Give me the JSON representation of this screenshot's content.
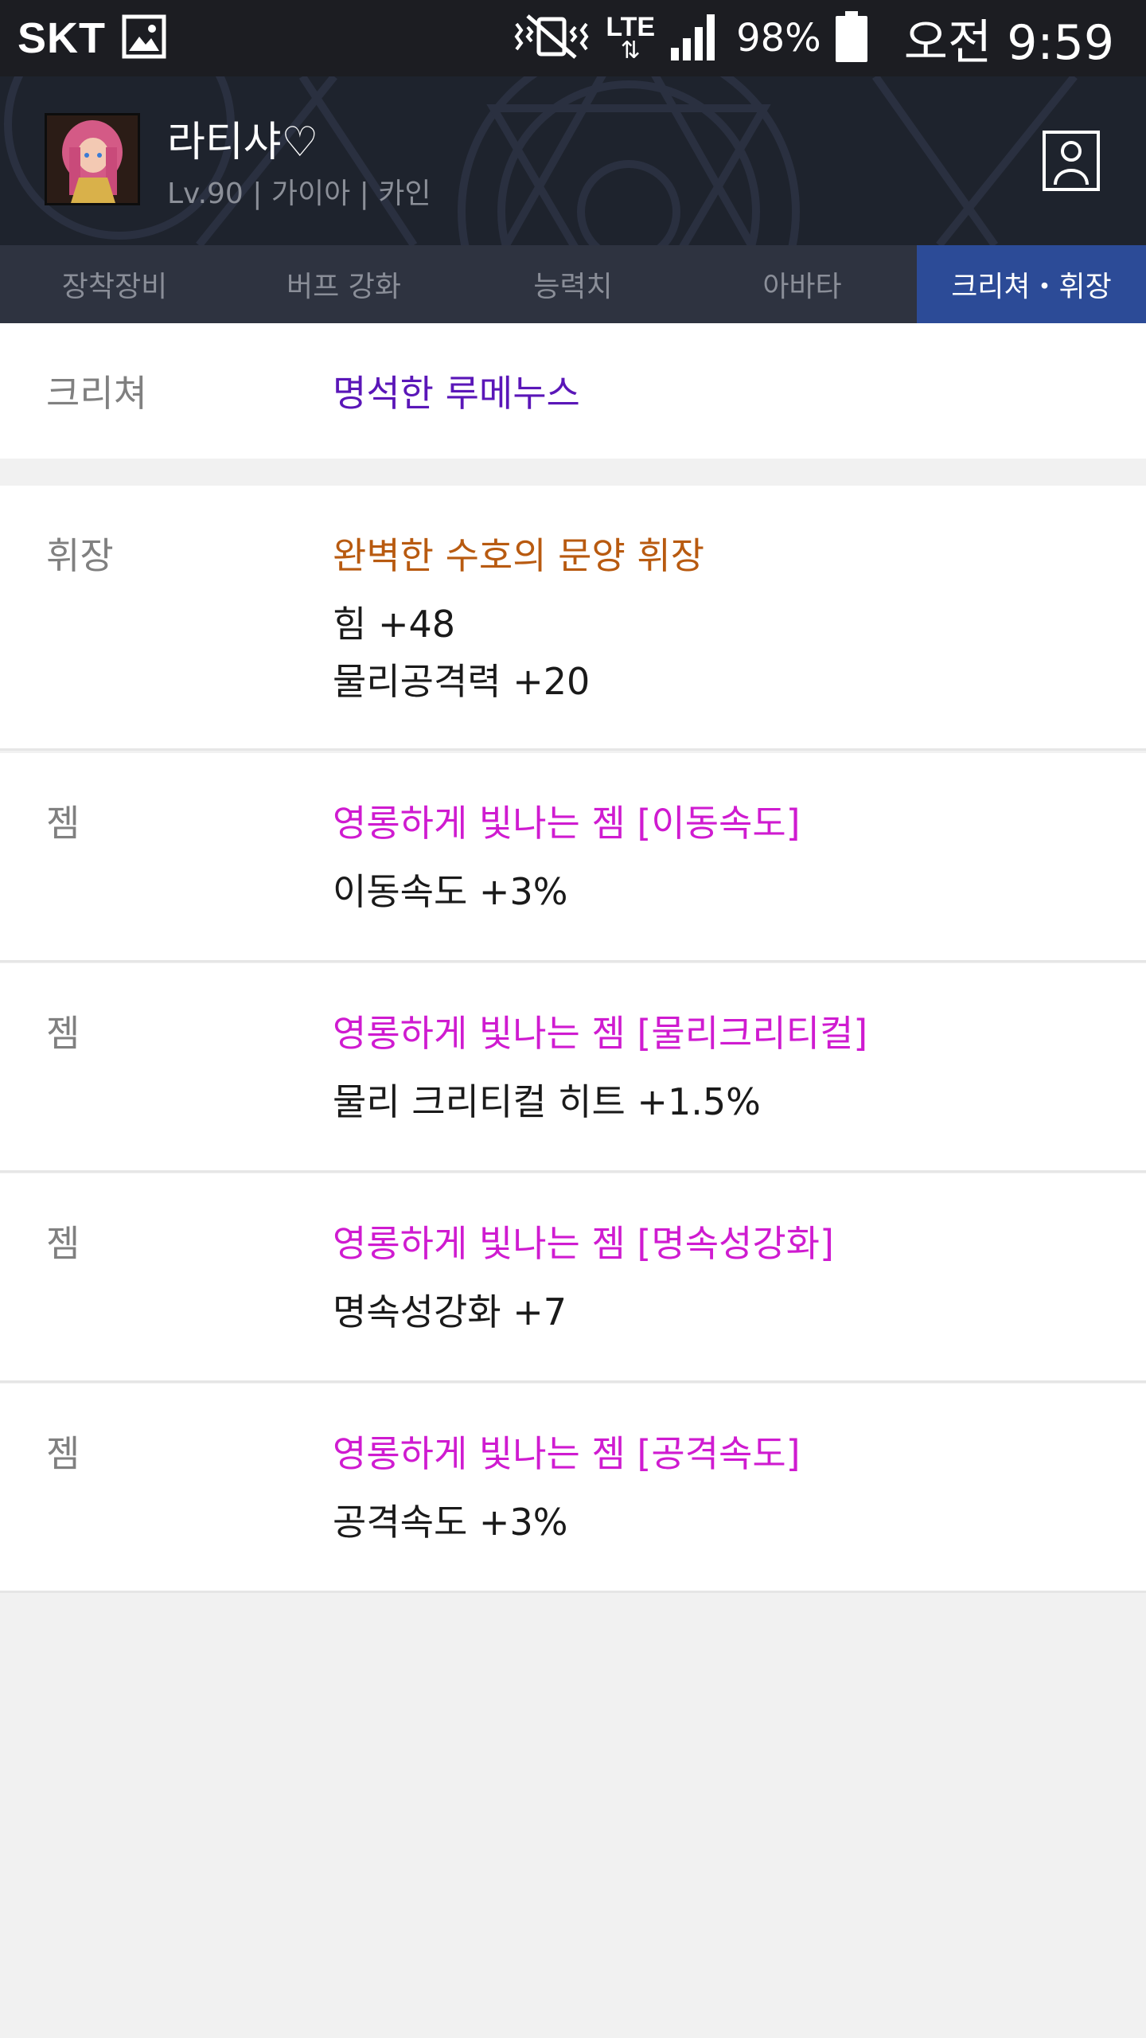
{
  "status_bar": {
    "carrier": "SKT",
    "network": "LTE",
    "battery": "98%",
    "time": "오전 9:59"
  },
  "header": {
    "character_name": "라티샤♡",
    "character_sub": "Lv.90 | 가이아 | 카인"
  },
  "tabs": [
    {
      "label": "장착장비",
      "active": false
    },
    {
      "label": "버프 강화",
      "active": false
    },
    {
      "label": "능력치",
      "active": false
    },
    {
      "label": "아바타",
      "active": false
    },
    {
      "label": "크리쳐・휘장",
      "active": true
    }
  ],
  "creature": {
    "label": "크리쳐",
    "name": "명석한 루메누스",
    "color": "#5a16b8"
  },
  "emblem": {
    "label": "휘장",
    "name": "완벽한 수호의 문양 휘장",
    "color": "#b85a10",
    "stats": [
      "힘 +48",
      "물리공격력 +20"
    ]
  },
  "gems": [
    {
      "label": "젬",
      "name": "영롱하게 빛나는 젬 [이동속도]",
      "stat": "이동속도 +3%"
    },
    {
      "label": "젬",
      "name": "영롱하게 빛나는 젬 [물리크리티컬]",
      "stat": "물리 크리티컬 히트 +1.5%"
    },
    {
      "label": "젬",
      "name": "영롱하게 빛나는 젬 [명속성강화]",
      "stat": "명속성강화 +7"
    },
    {
      "label": "젬",
      "name": "영롱하게 빛나는 젬 [공격속도]",
      "stat": "공격속도 +3%"
    }
  ],
  "colors": {
    "gem_name": "#cf1bd0",
    "active_tab": "#2c4b97"
  }
}
